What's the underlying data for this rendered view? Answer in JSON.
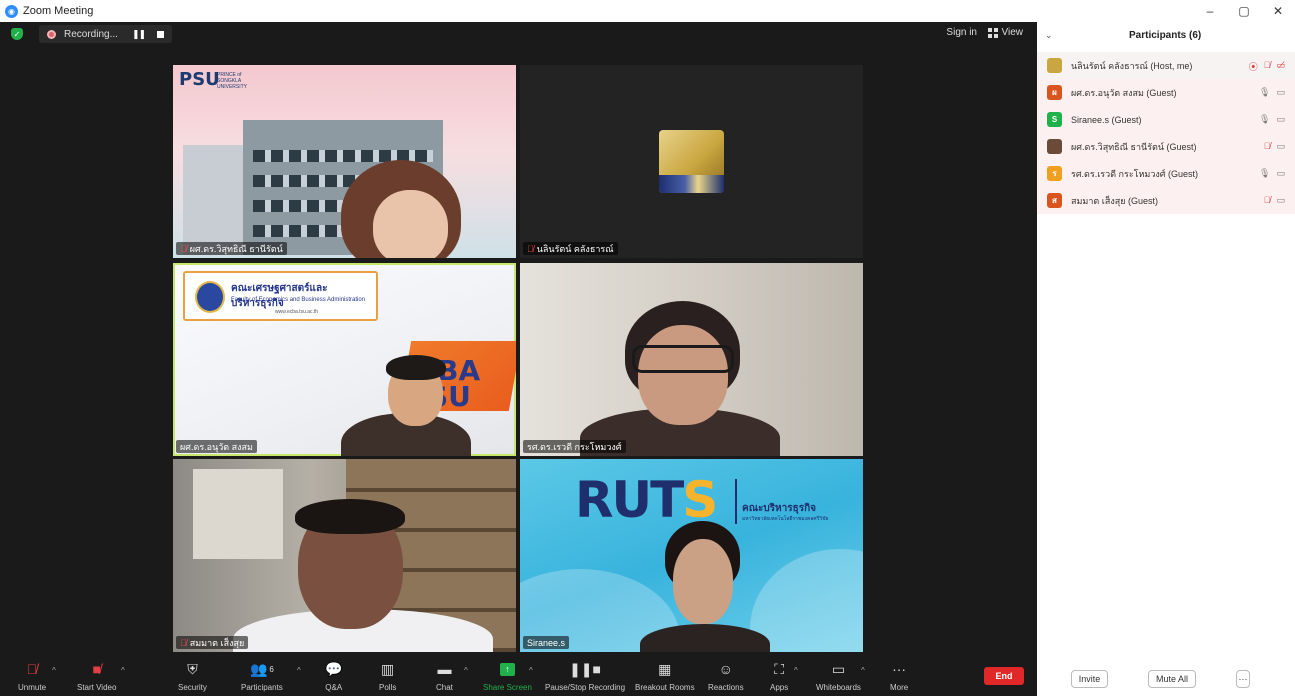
{
  "window": {
    "title": "Zoom Meeting",
    "controls": [
      "–",
      "▢",
      "✕"
    ]
  },
  "topbar": {
    "recording_label": "Recording...",
    "sign_in": "Sign in",
    "view": "View"
  },
  "tiles": [
    {
      "name": "ผศ.ดร.วิสุทธิณี ธานีรัตน์",
      "muted": true
    },
    {
      "name": "นลินรัตน์ คลังธารณ์",
      "muted": true
    },
    {
      "name": "ผศ.ดร.อนุวัต สงสม",
      "muted": false
    },
    {
      "name": "รศ.ดร.เรวดี กระโหมวงศ์",
      "muted": false
    },
    {
      "name": "สมมาต เส็งสุย",
      "muted": true
    },
    {
      "name": "Siranee.s",
      "muted": false
    }
  ],
  "tile_graphics": {
    "psu_logo": "PSU",
    "psu_sub": "PRINCE of SONGKLA UNIVERSITY",
    "fba_banner_title": "คณะเศรษฐศาสตร์และบริหารธุรกิจ",
    "fba_banner_sub": "Faculty of Economics and Business Administration",
    "fba_banner_web": "www.ecba.tsu.ac.th",
    "eba_text": "EBA\nSU",
    "ruts_text": "RUT",
    "ruts_s": "S",
    "ruts_thai": "คณะบริหารธุรกิจ",
    "ruts_sub": "มหาวิทยาลัยเทคโนโลยีราชมงคลศรีวิชัย"
  },
  "toolbar": {
    "unmute": "Unmute",
    "start_video": "Start Video",
    "security": "Security",
    "participants": "Participants",
    "participants_count": "6",
    "qa": "Q&A",
    "polls": "Polls",
    "chat": "Chat",
    "share_screen": "Share Screen",
    "pause_recording": "Pause/Stop Recording",
    "breakout_rooms": "Breakout Rooms",
    "reactions": "Reactions",
    "apps": "Apps",
    "whiteboards": "Whiteboards",
    "more": "More",
    "end": "End"
  },
  "panel": {
    "title": "Participants (6)",
    "participants": [
      {
        "name": "นลินรัตน์ คลังธารณ์ (Host, me)",
        "avatar": "",
        "avatar_color": "#c9a640",
        "mic": "muted",
        "video": "off",
        "recording": true
      },
      {
        "name": "ผศ.ดร.อนุวัต สงสม (Guest)",
        "avatar": "ผ",
        "avatar_color": "#d9541e",
        "mic": "on",
        "video": "off"
      },
      {
        "name": "Siranee.s (Guest)",
        "avatar": "S",
        "avatar_color": "#21b14b",
        "mic": "on",
        "video": "off"
      },
      {
        "name": "ผศ.ดร.วิสุทธิณี ธานีรัตน์ (Guest)",
        "avatar": "",
        "avatar_color": "#6b4a3a",
        "mic": "muted",
        "video": "off"
      },
      {
        "name": "รศ.ดร.เรวดี กระโหมวงศ์ (Guest)",
        "avatar": "ร",
        "avatar_color": "#f0a020",
        "mic": "on",
        "video": "off"
      },
      {
        "name": "สมมาต เส็งสุย (Guest)",
        "avatar": "ส",
        "avatar_color": "#d9541e",
        "mic": "muted",
        "video": "off"
      }
    ],
    "invite": "Invite",
    "mute_all": "Mute All",
    "more": "···"
  }
}
